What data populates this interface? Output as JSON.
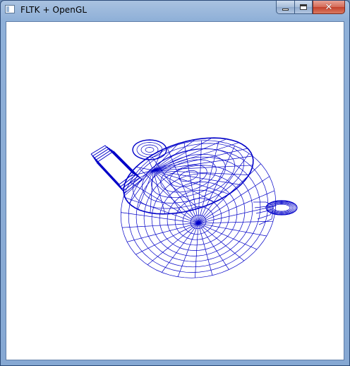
{
  "window": {
    "title": "FLTK + OpenGL",
    "caption_buttons": [
      "minimize",
      "maximize",
      "close"
    ]
  },
  "canvas": {
    "background": "#ffffff",
    "wire_color": "#0000c8",
    "content": "wireframe-teapot"
  }
}
